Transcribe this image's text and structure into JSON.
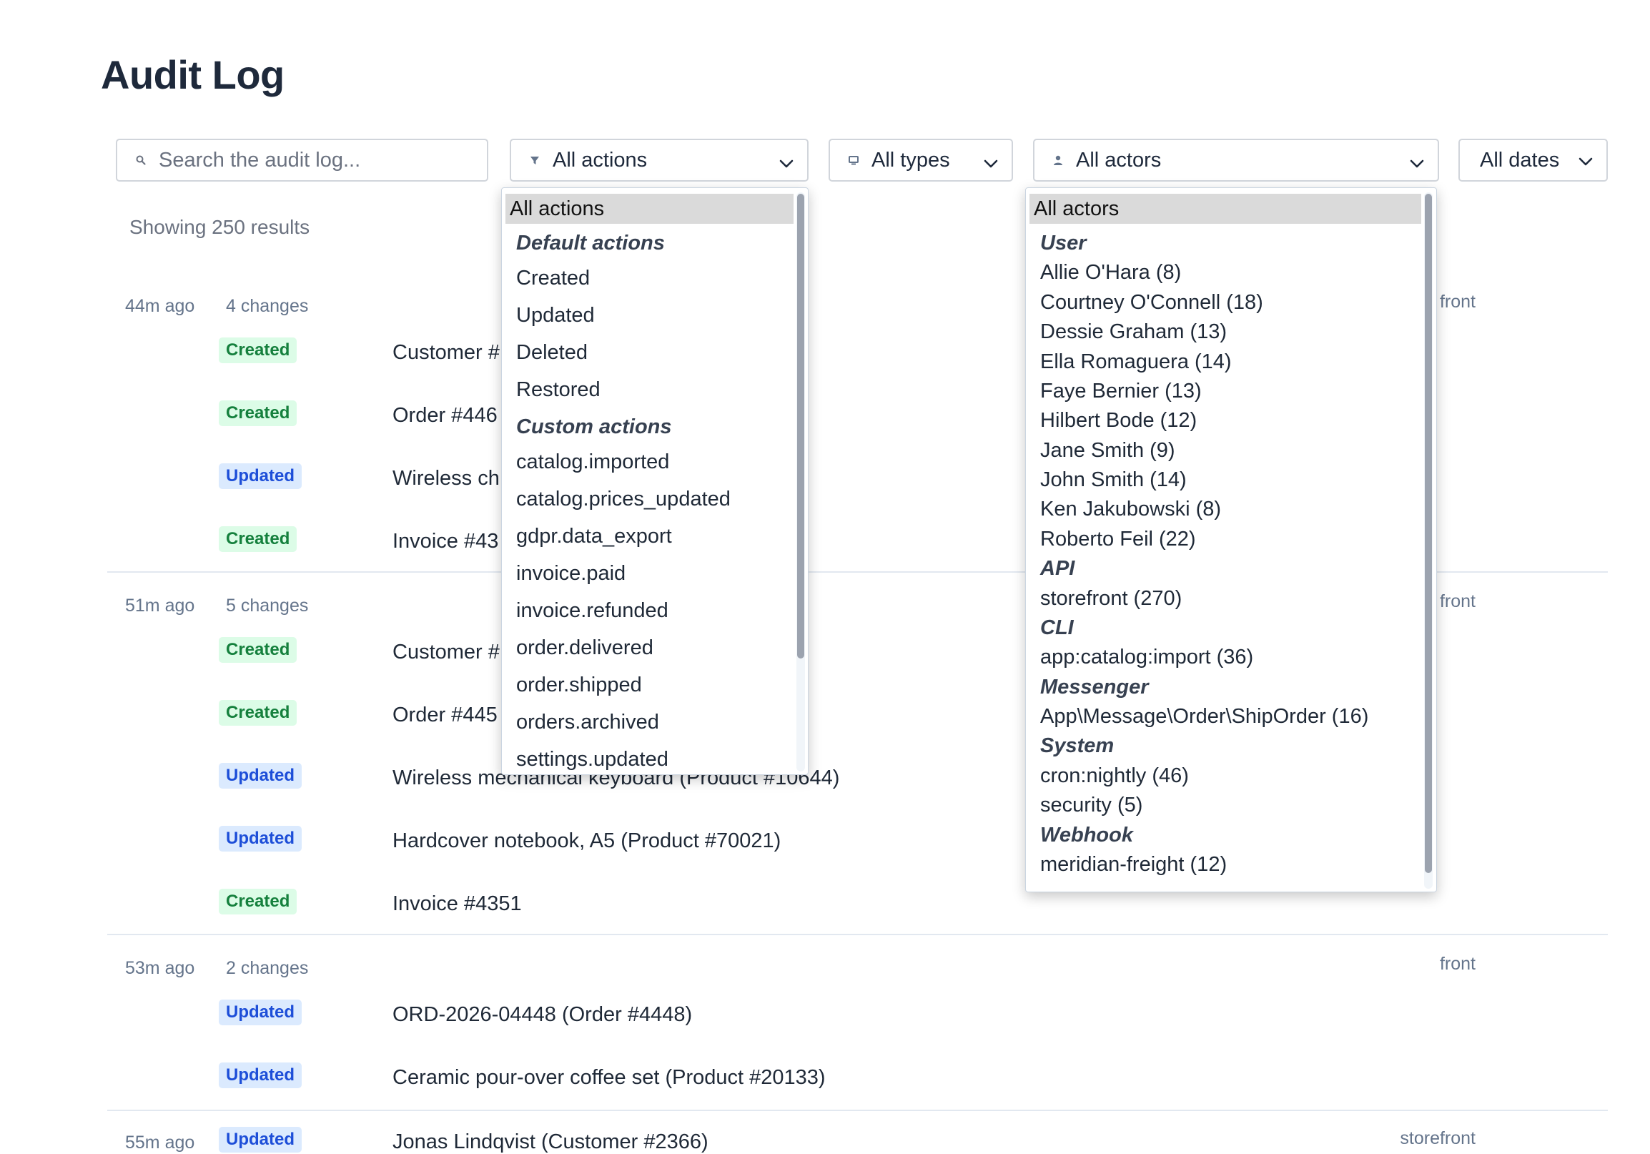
{
  "page": {
    "title": "Audit Log"
  },
  "filters": {
    "search_placeholder": "Search the audit log...",
    "actions_label": "All actions",
    "types_label": "All types",
    "actors_label": "All actors",
    "dates_label": "All dates"
  },
  "results_count": "Showing 250 results",
  "groups": [
    {
      "time": "44m ago",
      "changes": "4 changes",
      "source": "front",
      "rows": [
        {
          "badge": "Created",
          "text": "Customer #"
        },
        {
          "badge": "Created",
          "text": "Order #446"
        },
        {
          "badge": "Updated",
          "text": "Wireless ch"
        },
        {
          "badge": "Created",
          "text": "Invoice #43"
        }
      ]
    },
    {
      "time": "51m ago",
      "changes": "5 changes",
      "source": "front",
      "rows": [
        {
          "badge": "Created",
          "text": "Customer #"
        },
        {
          "badge": "Created",
          "text": "Order #445"
        },
        {
          "badge": "Updated",
          "text": "Wireless mechanical keyboard (Product #10644)"
        },
        {
          "badge": "Updated",
          "text": "Hardcover notebook, A5 (Product #70021)"
        },
        {
          "badge": "Created",
          "text": "Invoice #4351"
        }
      ]
    },
    {
      "time": "53m ago",
      "changes": "2 changes",
      "source": "front",
      "rows": [
        {
          "badge": "Updated",
          "text": "ORD-2026-04448 (Order #4448)"
        },
        {
          "badge": "Updated",
          "text": "Ceramic pour-over coffee set (Product #20133)"
        }
      ]
    },
    {
      "time": "55m ago",
      "source": "storefront",
      "rows": [
        {
          "badge": "Updated",
          "text": "Jonas Lindqvist (Customer #2366)"
        }
      ]
    }
  ],
  "actions_dropdown": {
    "selected": "All actions",
    "groups": [
      {
        "label": "Default actions",
        "items": [
          "Created",
          "Updated",
          "Deleted",
          "Restored"
        ]
      },
      {
        "label": "Custom actions",
        "items": [
          "catalog.imported",
          "catalog.prices_updated",
          "gdpr.data_export",
          "invoice.paid",
          "invoice.refunded",
          "order.delivered",
          "order.shipped",
          "orders.archived",
          "settings.updated"
        ]
      }
    ]
  },
  "actors_dropdown": {
    "selected": "All actors",
    "groups": [
      {
        "label": "User",
        "items": [
          "Allie O'Hara (8)",
          "Courtney O'Connell (18)",
          "Dessie Graham (13)",
          "Ella Romaguera (14)",
          "Faye Bernier (13)",
          "Hilbert Bode (12)",
          "Jane Smith (9)",
          "John Smith (14)",
          "Ken Jakubowski (8)",
          "Roberto Feil (22)"
        ]
      },
      {
        "label": "API",
        "items": [
          "storefront (270)"
        ]
      },
      {
        "label": "CLI",
        "items": [
          "app:catalog:import (36)"
        ]
      },
      {
        "label": "Messenger",
        "items": [
          "App\\Message\\Order\\ShipOrder (16)"
        ]
      },
      {
        "label": "System",
        "items": [
          "cron:nightly (46)",
          "security (5)"
        ]
      },
      {
        "label": "Webhook",
        "items": [
          "meridian-freight (12)"
        ]
      }
    ]
  }
}
